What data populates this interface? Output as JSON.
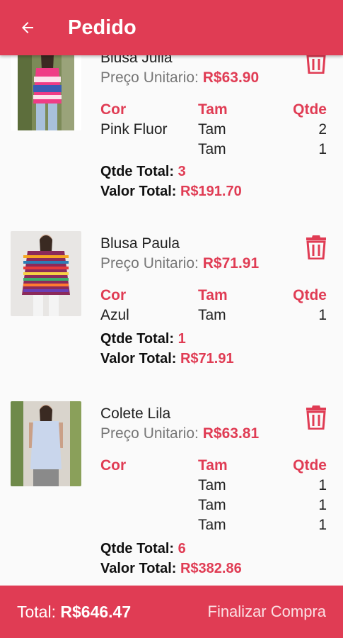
{
  "appbar": {
    "title": "Pedido",
    "back_icon": "arrow-back-icon"
  },
  "labels": {
    "col_color": "Cor",
    "col_size": "Tam",
    "col_qty": "Qtde",
    "unit_price": "Preço Unitario: ",
    "qty_total": "Qtde Total: ",
    "value_total": "Valor Total: "
  },
  "items": [
    {
      "name": "Blusa Julia",
      "unit_price": "R$63.90",
      "rows": [
        {
          "color": "Pink Fluor",
          "size": "Tam",
          "qty": "2"
        },
        {
          "color": "",
          "size": "Tam",
          "qty": "1"
        }
      ],
      "qty_total": "3",
      "value_total": "R$191.70"
    },
    {
      "name": "Blusa Paula",
      "unit_price": "R$71.91",
      "rows": [
        {
          "color": "Azul",
          "size": "Tam",
          "qty": "1"
        }
      ],
      "qty_total": "1",
      "value_total": "R$71.91"
    },
    {
      "name": "Colete Lila",
      "unit_price": "R$63.81",
      "rows": [
        {
          "color": "",
          "size": "Tam",
          "qty": "1"
        },
        {
          "color": "",
          "size": "Tam",
          "qty": "1"
        },
        {
          "color": "",
          "size": "Tam",
          "qty": "1"
        }
      ],
      "qty_total": "6",
      "value_total": "R$382.86"
    }
  ],
  "footer": {
    "total_label": "Total: ",
    "total_value": "R$646.47",
    "finalize_label": "Finalizar Compra"
  },
  "colors": {
    "accent": "#e03c54",
    "background": "#fafafa"
  }
}
